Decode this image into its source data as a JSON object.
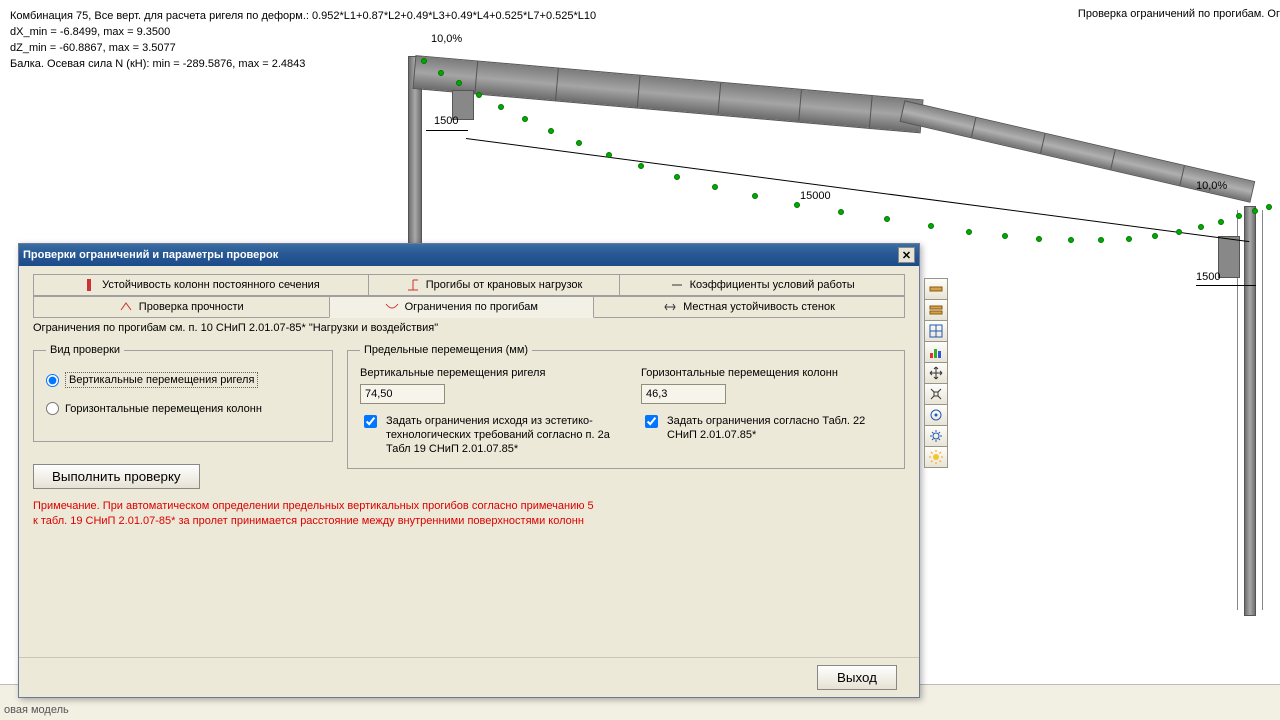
{
  "header": {
    "line1": "Комбинация 75, Все верт. для расчета ригеля по деформ.: 0.952*L1+0.87*L2+0.49*L3+0.49*L4+0.525*L7+0.525*L10",
    "line2": "dX_min =  -6.8499, max =    9.3500",
    "line3": "dZ_min =  -60.8867, max =    3.5077",
    "line4": "Балка. Осевая сила N (кН): min = -289.5876, max =    2.4843",
    "right": "Проверка ограничений по прогибам. Ог"
  },
  "dims": {
    "pct_left": "10,0%",
    "pct_right": "10,0%",
    "dim_vert1": "1500",
    "dim_vert2": "1500",
    "dim_span": "15000"
  },
  "dialog": {
    "title": "Проверки ограничений и параметры проверок",
    "tabs_row1": {
      "t1": "Устойчивость колонн постоянного сечения",
      "t2": "Прогибы от крановых нагрузок",
      "t3": "Коэффициенты условий работы"
    },
    "tabs_row2": {
      "t1": "Проверка прочности",
      "t2": "Ограничения по прогибам",
      "t3": "Местная устойчивость стенок"
    },
    "ref": "Ограничения по прогибам см. п. 10 СНиП 2.01.07-85* \"Нагрузки и воздействия\"",
    "group_mode": "Вид проверки",
    "radio1": "Вертикальные перемещения ригеля",
    "radio2": "Горизонтальные перемещения колонн",
    "run_btn": "Выполнить проверку",
    "group_limits": "Предельные перемещения (мм)",
    "lim_v_label": "Вертикальные перемещения ригеля",
    "lim_v_value": "74,50",
    "lim_h_label": "Горизонтальные перемещения колонн",
    "lim_h_value": "46,3",
    "cb_v": "Задать ограничения исходя из эстетико-технологических требований согласно п. 2а Табл 19 СНиП 2.01.07.85*",
    "cb_h": "Задать ограничения согласно Табл. 22 СНиП 2.01.07.85*",
    "note1": "Примечание. При автоматическом определении предельных вертикальных прогибов согласно примечанию 5",
    "note2": "к табл. 19 СНиП 2.01.07-85* за пролет принимается расстояние между внутренними поверхностями колонн",
    "exit": "Выход"
  },
  "statusbar": "овая  модель",
  "toolbar_icons": [
    "beam-icon",
    "beam2-icon",
    "grid-icon",
    "chart-icon",
    "move-icon",
    "expand-icon",
    "target-icon",
    "gear-icon",
    "sun-icon"
  ]
}
